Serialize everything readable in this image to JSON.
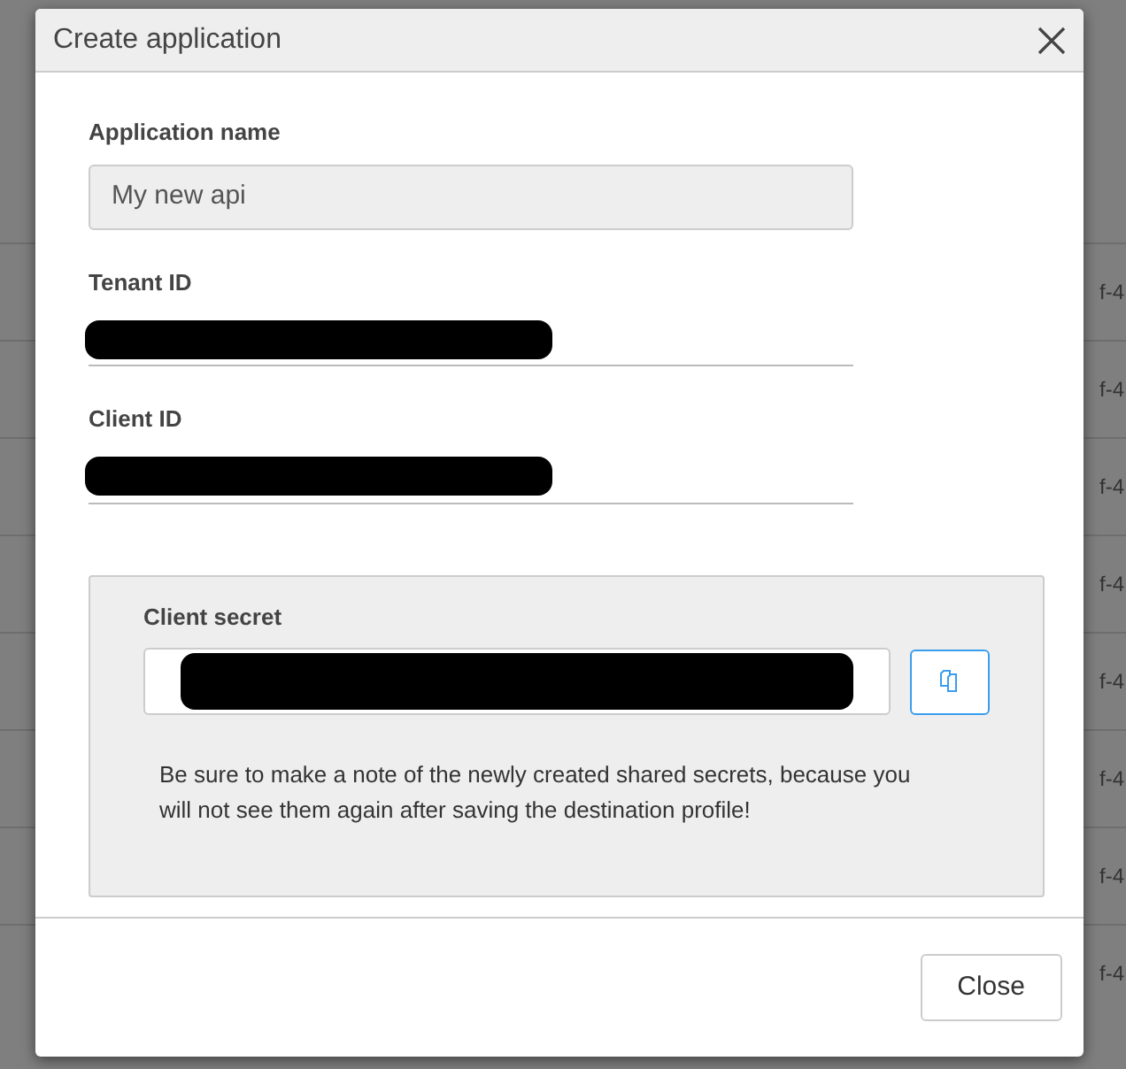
{
  "background_rows": [
    {
      "cell": "f-4"
    },
    {
      "cell": "f-4"
    },
    {
      "cell": "f-4"
    },
    {
      "cell": "f-4"
    },
    {
      "cell": "f-4"
    },
    {
      "cell": "f-4"
    },
    {
      "cell": "f-4"
    },
    {
      "cell": "f-4"
    }
  ],
  "dialog": {
    "title": "Create application",
    "fields": [
      {
        "kind": "input",
        "label": "Application name",
        "value": "My new api"
      },
      {
        "kind": "redacted",
        "label": "Tenant ID"
      },
      {
        "kind": "redacted",
        "label": "Client ID"
      }
    ],
    "secret": {
      "label": "Client secret",
      "note": "Be sure to make a note of the newly created shared secrets, because you will not see them again after saving the destination profile!"
    },
    "buttons": [
      "Close"
    ]
  }
}
